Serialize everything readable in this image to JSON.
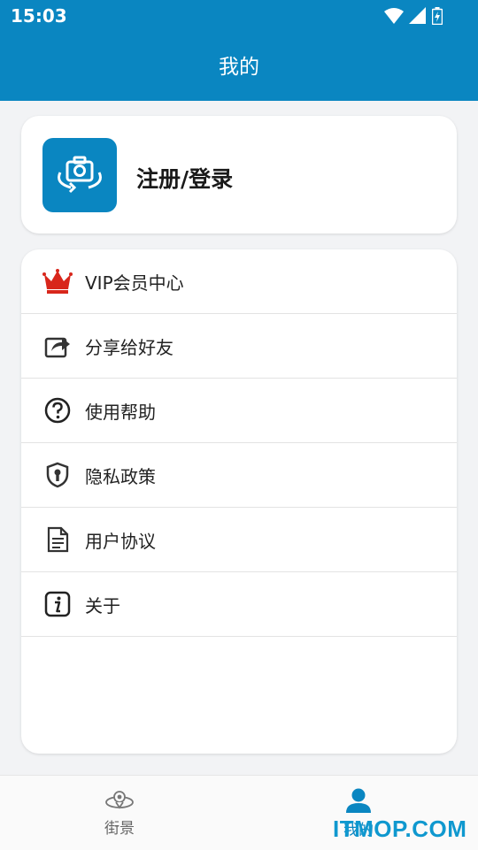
{
  "status_bar": {
    "time": "15:03"
  },
  "app_bar": {
    "title": "我的"
  },
  "login": {
    "label": "注册/登录"
  },
  "menu": {
    "items": [
      {
        "label": "VIP会员中心",
        "icon": "crown-icon"
      },
      {
        "label": "分享给好友",
        "icon": "share-icon"
      },
      {
        "label": "使用帮助",
        "icon": "help-icon"
      },
      {
        "label": "隐私政策",
        "icon": "shield-icon"
      },
      {
        "label": "用户协议",
        "icon": "document-icon"
      },
      {
        "label": "关于",
        "icon": "info-icon"
      }
    ]
  },
  "bottom_nav": {
    "tabs": [
      {
        "label": "街景",
        "icon": "street-view-icon",
        "active": false
      },
      {
        "label": "我的",
        "icon": "user-icon",
        "active": true
      }
    ]
  },
  "watermark": {
    "text": "ITMOP.COM"
  },
  "colors": {
    "primary": "#0a86c1",
    "crown": "#d8261b"
  }
}
